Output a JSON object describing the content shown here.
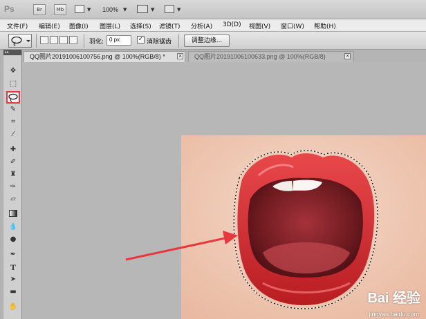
{
  "appbar": {
    "logo": "Ps",
    "br_label": "Br",
    "mb_label": "Mb",
    "zoom": "100%"
  },
  "menu": [
    "文件(F)",
    "编辑(E)",
    "图像(I)",
    "图层(L)",
    "选择(S)",
    "滤镜(T)",
    "分析(A)",
    "3D(D)",
    "视图(V)",
    "窗口(W)",
    "帮助(H)"
  ],
  "options": {
    "feather_label": "羽化:",
    "feather_value": "0 px",
    "antialias_checked": true,
    "antialias_label": "消除锯齿",
    "refine_edge_label": "调整边缘..."
  },
  "tabs": [
    {
      "title": "QQ图片20191006100756.png @ 100%(RGB/8) *",
      "active": true
    },
    {
      "title": "QQ图片20191006100633.png @ 100%(RGB/8)",
      "active": false
    }
  ],
  "tools": [
    "move-tool",
    "rect-marquee-tool",
    "lasso-tool",
    "quick-select-tool",
    "crop-tool",
    "eyedropper-tool",
    "healing-brush-tool",
    "brush-tool",
    "clone-stamp-tool",
    "history-brush-tool",
    "eraser-tool",
    "gradient-tool",
    "blur-tool",
    "dodge-tool",
    "pen-tool",
    "type-tool",
    "path-select-tool",
    "shape-tool",
    "hand-tool"
  ],
  "selected_tool": "lasso-tool",
  "watermark": {
    "brand": "Bai 经验",
    "url": "jingyan.baidu.com"
  },
  "colors": {
    "highlight": "#e8383d",
    "arrow": "#e8383d",
    "lips": "#d3282c",
    "skin": "#f1cdb7"
  }
}
